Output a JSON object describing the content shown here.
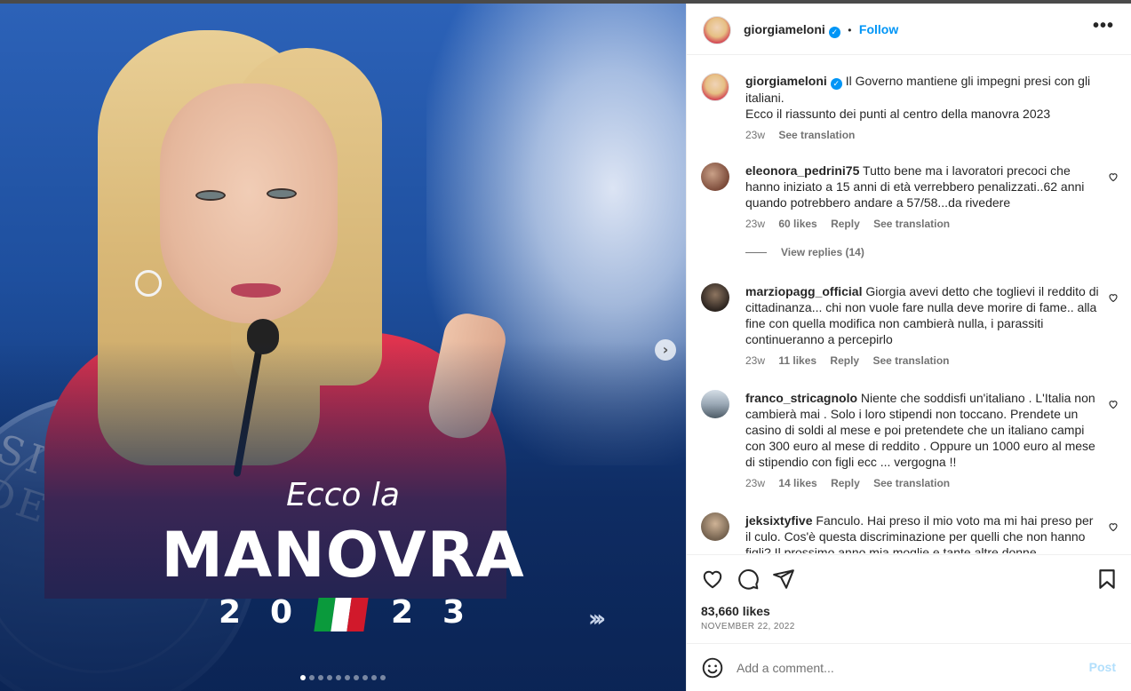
{
  "post": {
    "headline_script": "Ecco la",
    "headline_main": "MANOVRA",
    "year_digits": [
      "2",
      "0",
      "2",
      "3"
    ],
    "chevrons": "›››",
    "next_icon": "›",
    "carousel_dots": 10,
    "carousel_active_index": 0,
    "flag_colors": [
      "#0a9a3c",
      "#ffffff",
      "#d1192b"
    ]
  },
  "header": {
    "username": "giorgiameloni",
    "verified_icon": "✓",
    "separator": "•",
    "follow_label": "Follow",
    "more_icon": "•••"
  },
  "caption": {
    "username": "giorgiameloni",
    "text_line1": "Il Governo mantiene gli impegni presi con gli italiani.",
    "text_line2": "Ecco il riassunto dei punti al centro della manovra 2023",
    "time": "23w",
    "translation": "See translation"
  },
  "comments": [
    {
      "username": "eleonora_pedrini75",
      "text": "Tutto bene ma i lavoratori precoci che hanno iniziato a 15 anni di età verrebbero penalizzati..62 anni quando potrebbero andare a 57/58...da rivedere",
      "time": "23w",
      "likes": "60 likes",
      "reply": "Reply",
      "translation": "See translation"
    },
    {
      "username": "marziopagg_official",
      "text": "Giorgia avevi detto che toglievi il reddito di cittadinanza... chi non vuole fare nulla deve morire di fame.. alla fine con quella modifica non cambierà nulla, i parassiti continueranno a percepirlo",
      "time": "23w",
      "likes": "11 likes",
      "reply": "Reply",
      "translation": "See translation"
    },
    {
      "username": "franco_stricagnolo",
      "text": "Niente che soddisfi un'italiano . L'Italia non cambierà mai . Solo i loro stipendi non toccano. Prendete un casino di soldi al mese e poi pretendete che un italiano campi con 300 euro al mese di reddito . Oppure un 1000 euro al mese di stipendio con figli ecc ... vergogna !!",
      "time": "23w",
      "likes": "14 likes",
      "reply": "Reply",
      "translation": "See translation"
    },
    {
      "username": "jeksixtyfive",
      "text": "Fanculo. Hai preso il mio voto ma mi hai preso per il culo. Cos'è questa discriminazione per quelli che non hanno figli? Il prossimo anno mia moglie e tante altre donne",
      "time": "",
      "likes": "",
      "reply": "",
      "translation": ""
    }
  ],
  "view_replies": "View replies (14)",
  "footer": {
    "likes": "83,660 likes",
    "date": "NOVEMBER 22, 2022",
    "comment_placeholder": "Add a comment...",
    "post_label": "Post"
  }
}
